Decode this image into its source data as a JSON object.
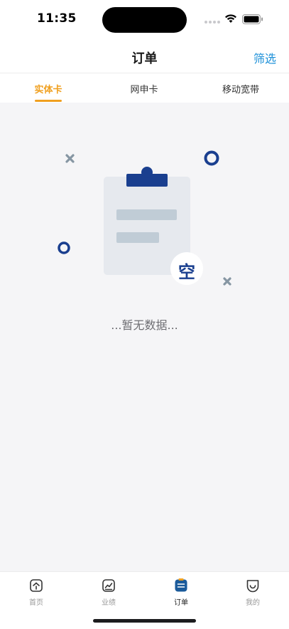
{
  "status_bar": {
    "time": "11:35"
  },
  "nav": {
    "title": "订单",
    "filter_label": "筛选"
  },
  "tabs": [
    {
      "label": "实体卡",
      "active": true
    },
    {
      "label": "网申卡",
      "active": false
    },
    {
      "label": "移动宽带",
      "active": false
    }
  ],
  "empty_state": {
    "badge_char": "空",
    "message": "...暂无数据..."
  },
  "tabbar": [
    {
      "label": "首页",
      "icon": "home-icon",
      "active": false
    },
    {
      "label": "业绩",
      "icon": "chart-icon",
      "active": false
    },
    {
      "label": "订单",
      "icon": "order-icon",
      "active": true
    },
    {
      "label": "我的",
      "icon": "profile-icon",
      "active": false
    }
  ],
  "colors": {
    "accent": "#f0a020",
    "link": "#1a8fd8",
    "illustration_blue": "#1a3f8f"
  }
}
